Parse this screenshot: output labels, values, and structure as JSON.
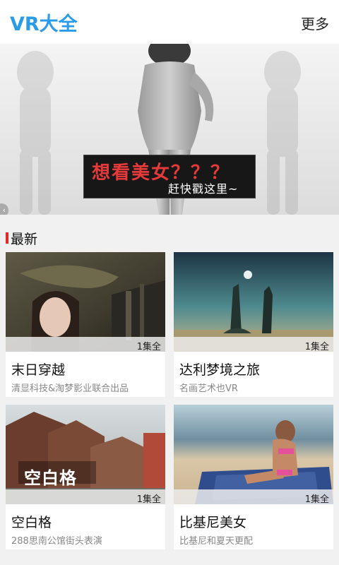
{
  "header": {
    "title": "VR大全",
    "more_label": "更多"
  },
  "banner": {
    "line1": "想看美女？？？",
    "line2": "赶快戳这里~"
  },
  "section": {
    "title": "最新"
  },
  "cards": [
    {
      "title": "末日穿越",
      "desc": "清显科技&淘梦影业联合出品",
      "badge": "1集全",
      "thumb_text": ""
    },
    {
      "title": "达利梦境之旅",
      "desc": "名画艺术也VR",
      "badge": "1集全",
      "thumb_text": ""
    },
    {
      "title": "空白格",
      "desc": "288思南公馆街头表演",
      "badge": "1集全",
      "thumb_text": "空白格"
    },
    {
      "title": "比基尼美女",
      "desc": "比基尼和夏天更配",
      "badge": "1集全",
      "thumb_text": ""
    }
  ],
  "colors": {
    "accent": "#2a9be8",
    "section_marker": "#e22727",
    "banner_red_text": "#e53a3a"
  }
}
